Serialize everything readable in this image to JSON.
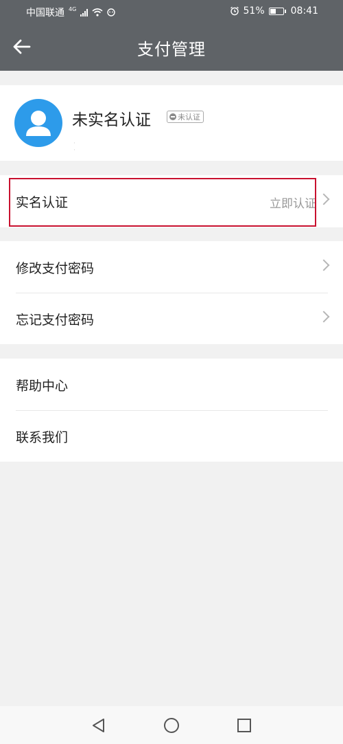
{
  "status_bar": {
    "carrier": "中国联通",
    "network_type": "4G",
    "battery_percent": "51%",
    "battery_level": 0.51,
    "time": "08:41"
  },
  "header": {
    "title": "支付管理"
  },
  "profile": {
    "name": "未实名认证",
    "badge": "未认证",
    "subtext": "·  ·"
  },
  "menu": {
    "verify": {
      "label": "实名认证",
      "value": "立即认证"
    },
    "change_password": {
      "label": "修改支付密码"
    },
    "forgot_password": {
      "label": "忘记支付密码"
    },
    "help": {
      "label": "帮助中心"
    },
    "contact": {
      "label": "联系我们"
    }
  },
  "colors": {
    "header_bg": "#5f6367",
    "avatar_bg": "#2d9bea",
    "highlight": "#c8102e"
  },
  "icons": [
    "back-arrow-icon",
    "alarm-icon",
    "wifi-icon",
    "battery-icon",
    "chevron-right-icon",
    "nav-back-icon",
    "nav-home-icon",
    "nav-recent-icon"
  ]
}
